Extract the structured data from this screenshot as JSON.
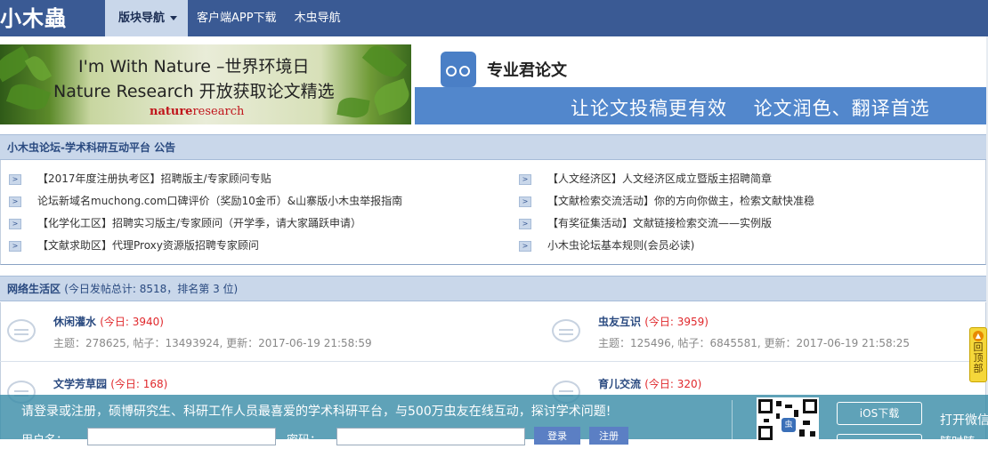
{
  "header": {
    "logo_text": "小木蟲",
    "nav": [
      {
        "label": "版块导航",
        "active": true
      },
      {
        "label": "客户端APP下载",
        "active": false
      },
      {
        "label": "木虫导航",
        "active": false
      }
    ]
  },
  "banner_left": {
    "line1": "I'm With Nature –世界环境日",
    "line2": "Nature Research 开放获取论文精选",
    "brand_a": "nature",
    "brand_b": "research"
  },
  "banner_right": {
    "title": "专业君论文",
    "slogan": "让论文投稿更有效　 论文润色、翻译首选"
  },
  "announcement": {
    "heading": "小木虫论坛-学术科研互动平台 公告",
    "left": [
      "【2017年度注册执考区】招聘版主/专家顾问专贴",
      "论坛新域名muchong.com口碑评价（奖励10金币）&山寨版小木虫举报指南",
      "【化学化工区】招聘实习版主/专家顾问（开学季，请大家踊跃申请）",
      "【文献求助区】代理Proxy资源版招聘专家顾问"
    ],
    "right": [
      "【人文经济区】人文经济区成立暨版主招聘简章",
      "【文献检索交流活动】你的方向你做主，检索文献快准稳",
      "【有奖征集活动】文献链接检索交流——实例版",
      "小木虫论坛基本规则(会员必读)"
    ]
  },
  "forum_zone": {
    "heading": "网络生活区",
    "stats": "(今日发帖总计: 8518，排名第 3 位)",
    "forums": [
      {
        "name": "休闲灌水",
        "today": "(今日: 3940)",
        "meta": "主题：278625, 帖子：13493924, 更新：2017-06-19 21:58:59"
      },
      {
        "name": "虫友互识",
        "today": "(今日: 3959)",
        "meta": "主题：125496, 帖子：6845581, 更新：2017-06-19 21:58:25"
      },
      {
        "name": "文学芳草园",
        "today": "(今日: 168)",
        "meta": ""
      },
      {
        "name": "育儿交流",
        "today": "(今日: 320)",
        "meta": ""
      }
    ]
  },
  "login_bar": {
    "message": "请登录或注册，硕博研究生、科研工作人员最喜爱的学术科研平台，与500万虫友在线互动，探讨学术问题!",
    "username_label": "用户名：",
    "password_label": "密码：",
    "login_btn": "登录",
    "register_btn": "注册",
    "qr_badge": "虫",
    "ios_btn": "iOS下载",
    "open_text": "打开微信",
    "open_text2": "随时随"
  },
  "back_top": {
    "label": "回顶部"
  }
}
